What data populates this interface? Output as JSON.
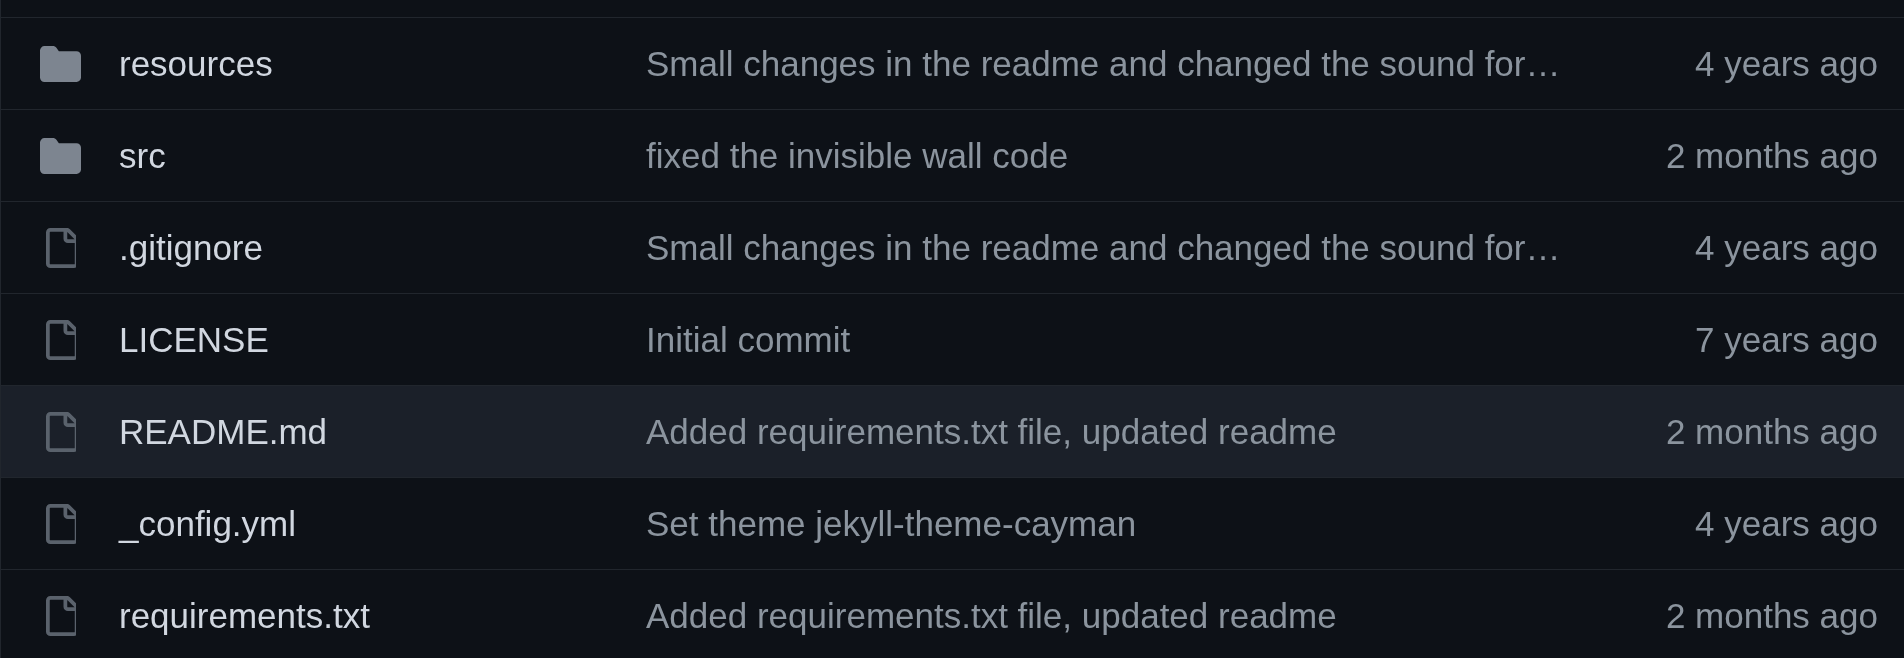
{
  "rows": [
    {
      "kind": "folder",
      "name": "resources",
      "message": "Small changes in the readme and changed the sound for…",
      "age": "4 years ago",
      "hovered": false
    },
    {
      "kind": "folder",
      "name": "src",
      "message": "fixed the invisible wall code",
      "age": "2 months ago",
      "hovered": false
    },
    {
      "kind": "file",
      "name": ".gitignore",
      "message": "Small changes in the readme and changed the sound for…",
      "age": "4 years ago",
      "hovered": false
    },
    {
      "kind": "file",
      "name": "LICENSE",
      "message": "Initial commit",
      "age": "7 years ago",
      "hovered": false
    },
    {
      "kind": "file",
      "name": "README.md",
      "message": "Added requirements.txt file, updated readme",
      "age": "2 months ago",
      "hovered": true
    },
    {
      "kind": "file",
      "name": "_config.yml",
      "message": "Set theme jekyll-theme-cayman",
      "age": "4 years ago",
      "hovered": false
    },
    {
      "kind": "file",
      "name": "requirements.txt",
      "message": "Added requirements.txt file, updated readme",
      "age": "2 months ago",
      "hovered": false
    }
  ]
}
